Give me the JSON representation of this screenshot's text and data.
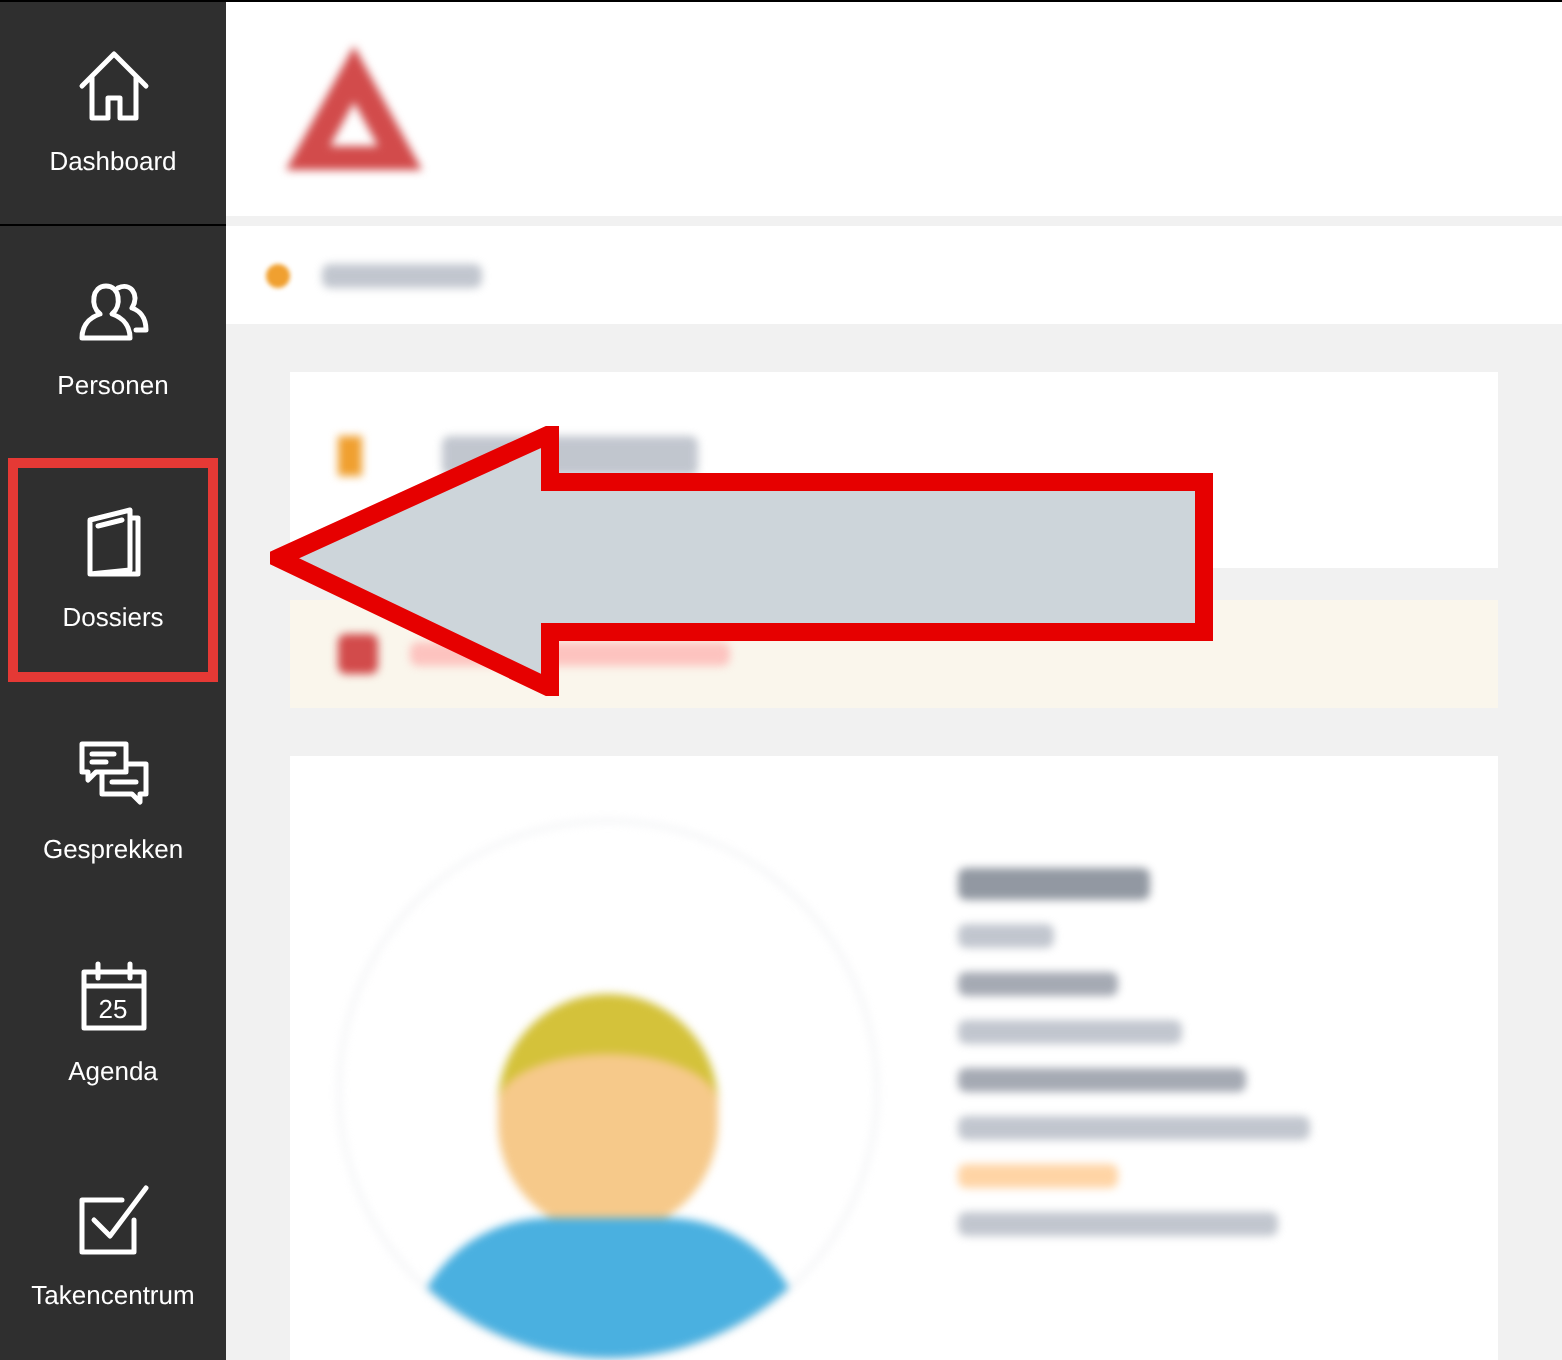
{
  "sidebar": {
    "items": [
      {
        "label": "Dashboard",
        "highlighted": false
      },
      {
        "label": "Personen",
        "highlighted": false
      },
      {
        "label": "Dossiers",
        "highlighted": true
      },
      {
        "label": "Gesprekken",
        "highlighted": false
      },
      {
        "label": "Agenda",
        "highlighted": false,
        "day": "25"
      },
      {
        "label": "Takencentrum",
        "highlighted": false
      }
    ]
  }
}
